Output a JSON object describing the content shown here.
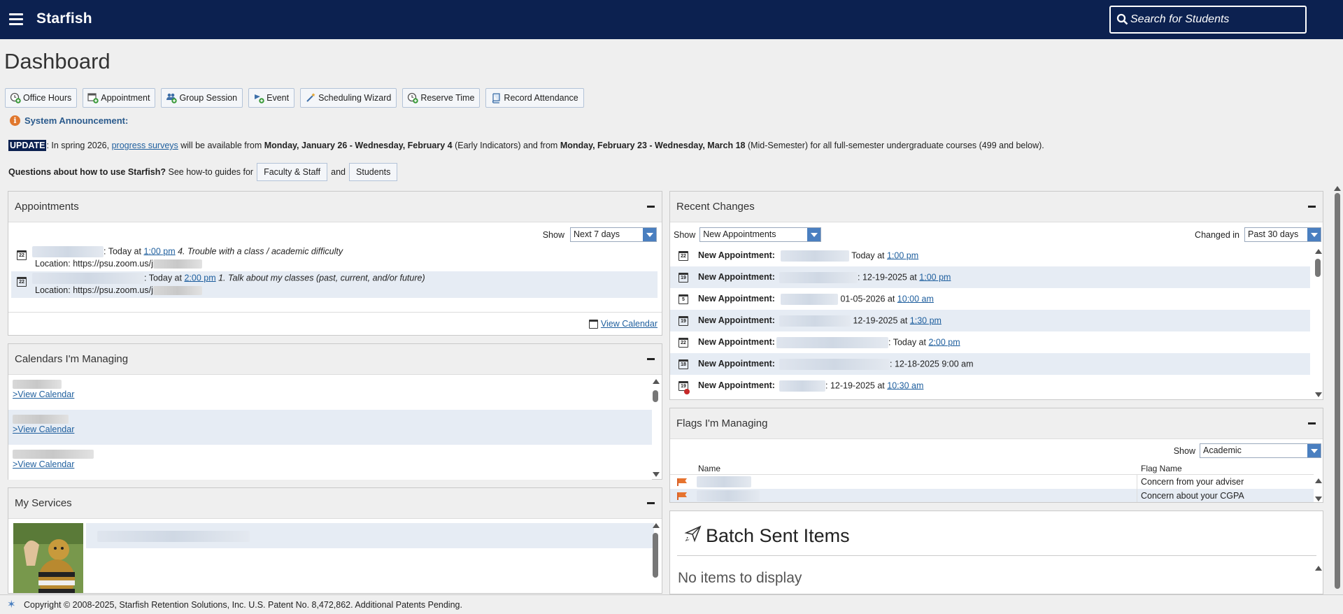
{
  "app": {
    "brand": "Starfish",
    "search_placeholder": "Search for Students"
  },
  "page_title": "Dashboard",
  "toolbar": [
    {
      "label": "Office Hours",
      "icon": "clock-add-icon"
    },
    {
      "label": "Appointment",
      "icon": "calendar-add-icon"
    },
    {
      "label": "Group Session",
      "icon": "group-add-icon"
    },
    {
      "label": "Event",
      "icon": "event-add-icon"
    },
    {
      "label": "Scheduling Wizard",
      "icon": "wand-icon"
    },
    {
      "label": "Reserve Time",
      "icon": "clock-reserve-icon"
    },
    {
      "label": "Record Attendance",
      "icon": "book-icon"
    }
  ],
  "announcement": {
    "title": "System Announcement:",
    "update_tag": "UPDATE",
    "t1": ": In spring 2026, ",
    "link": "progress surveys",
    "t2": " will be available from ",
    "b1": "Monday, January 26 - Wednesday, February 4",
    "t3": " (Early Indicators) and from ",
    "b2": "Monday, February 23 - Wednesday, March 18",
    "t4": " (Mid-Semester) for all full-semester undergraduate courses (499 and below)."
  },
  "howto": {
    "question": "Questions about how to use Starfish?",
    "text": " See how-to guides for",
    "btn1": "Faculty & Staff",
    "and": "and",
    "btn2": "Students"
  },
  "appointments": {
    "title": "Appointments",
    "show_label": "Show",
    "show_value": "Next 7 days",
    "rows": [
      {
        "day": "22",
        "when": ": Today at ",
        "time": "1:00 pm",
        "reason": " 4. Trouble with a class / academic difficulty",
        "location": "Location: https://psu.zoom.us/j"
      },
      {
        "day": "22",
        "when": ": Today at ",
        "time": "2:00 pm",
        "reason": " 1. Talk about my classes (past, current, and/or future)",
        "location": "Location: https://psu.zoom.us/j"
      }
    ],
    "view_calendar": "View Calendar"
  },
  "calendars": {
    "title": "Calendars I'm Managing",
    "link": ">View Calendar"
  },
  "services": {
    "title": "My Services"
  },
  "recent": {
    "title": "Recent Changes",
    "show_label": "Show",
    "show_value": "New Appointments",
    "changed_label": "Changed in",
    "changed_value": "Past 30 days",
    "rows": [
      {
        "day": "22",
        "label": "New Appointment:",
        "text": " Today at ",
        "link": "1:00 pm"
      },
      {
        "day": "19",
        "label": "New Appointment:",
        "text": ": 12-19-2025 at ",
        "link": "1:00 pm"
      },
      {
        "day": "5",
        "label": "New Appointment:",
        "text": " 01-05-2026 at ",
        "link": "10:00 am"
      },
      {
        "day": "19",
        "label": "New Appointment:",
        "text": " 12-19-2025 at ",
        "link": "1:30 pm"
      },
      {
        "day": "22",
        "label": "New Appointment:",
        "text": ": Today at ",
        "link": "2:00 pm"
      },
      {
        "day": "18",
        "label": "New Appointment:",
        "text": ": 12-18-2025 9:00 am",
        "link": ""
      },
      {
        "day": "19",
        "label": "New Appointment:",
        "text": ": 12-19-2025 at ",
        "link": "10:30 am"
      }
    ]
  },
  "flags": {
    "title": "Flags I'm Managing",
    "show_label": "Show",
    "show_value": "Academic",
    "col_name": "Name",
    "col_flag": "Flag Name",
    "rows": [
      {
        "flag": "Concern from your adviser"
      },
      {
        "flag": "Concern about your CGPA"
      }
    ]
  },
  "batch": {
    "title": "Batch Sent Items",
    "empty": "No items to display"
  },
  "footer": "Copyright © 2008-2025, Starfish Retention Solutions, Inc. U.S. Patent No. 8,472,862. Additional Patents Pending."
}
